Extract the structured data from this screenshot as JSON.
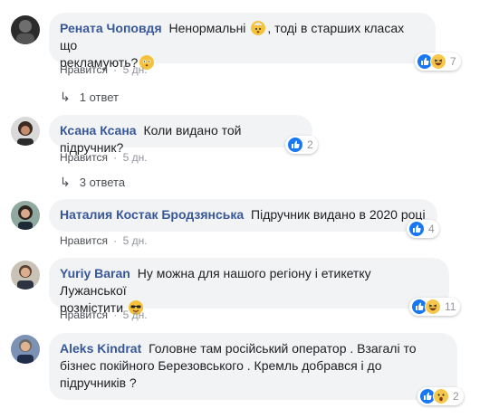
{
  "comments": [
    {
      "name": "Рената Чоповдя",
      "text_before": "Ненормальні",
      "emoji1": "exploding-head",
      "text_mid": ", тоді в старших класах що",
      "text_line2": "рекламують?",
      "emoji2": "flushed-face",
      "like": "Нравится",
      "time": "5 дн.",
      "reaction_count": "7",
      "replies": "1 ответ"
    },
    {
      "name": "Ксана Ксана",
      "text": "Коли видано той підручник?",
      "like": "Нравится",
      "time": "5 дн.",
      "reaction_count": "2",
      "replies": "3 ответа"
    },
    {
      "name": "Наталия Костак Бродзянська",
      "text": "Підручник видано в 2020 році",
      "like": "Нравится",
      "time": "5 дн.",
      "reaction_count": "4"
    },
    {
      "name": "Yuriy Baran",
      "text_line1": "Ну можна для нашого регіону і етикетку Лужанської",
      "text_line2": "розмістити",
      "emoji": "sunglasses-face",
      "like": "Нравится",
      "time": "5 дн.",
      "reaction_count": "11"
    },
    {
      "name": "Aleks Kindrat",
      "text_line1": "Головне там російський оператор . Взагалі то",
      "text_line2": "бізнес покійного Березовського . Кремль добрався і до",
      "text_line3": "підручників ?",
      "like": "Нравится",
      "time": "5 дн.",
      "reaction_count": "2"
    }
  ],
  "separator": "·",
  "reply_arrow": "↳",
  "colors": {
    "link": "#385898",
    "bubble": "#f2f3f5",
    "like_blue": "#1877f2"
  }
}
